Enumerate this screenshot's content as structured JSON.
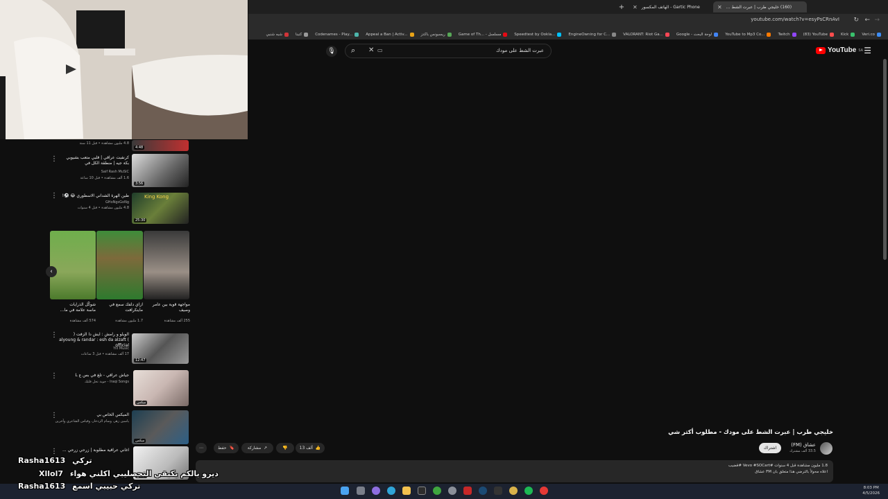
{
  "browser": {
    "tabs": [
      {
        "title": "Gartic Phone - الهاتف المكسور"
      },
      {
        "title": "(160) خليجي طرب | عبرت الشط ..."
      }
    ],
    "url": "youtube.com/watch?v=esyPsCRnAvI",
    "bookmarks": [
      "Veri.co",
      "Kick",
      "(83) YouTube",
      "Twitch",
      "YouTube to Mp3 Co...",
      "Google - لوحة البحث",
      "VALORANT: Riot Ga...",
      "EngineOwning for C...",
      "Speedtest by Ookla...",
      "Game of Th... - مسلسل",
      "ريسبونس باكدز",
      "Appeal a Ban | Activ...",
      "Codenames - Play...",
      "كتبنا",
      "شبه شنبي"
    ]
  },
  "youtube": {
    "logo_text": "YouTube",
    "region": "SA",
    "search_value": "عبرت الشط على مودك"
  },
  "sidebar": {
    "items": [
      {
        "title": "",
        "channel": "",
        "meta": "4.8 مليون مشاهدة • قبل 11 سنة",
        "duration": "4:48"
      },
      {
        "title": "كرنفيت عراقي | قلبي متعب بشيوبي بكة جيه | منطقة الكل في",
        "channel": "Saif Rash MuSiC",
        "meta": "1.6 ألف مشاهدة • قبل 10 ساعة",
        "duration": "3:56"
      },
      {
        "title": "طين الهرة الشداني الاسطوري 😂 ⚽!",
        "channel": "GHoNgsGoNg",
        "meta": "4.8 مليون مشاهدة • قبل 4 سنوات",
        "duration": "25:30"
      },
      {
        "title": "الويلو و رامش : ايش دا الزفت ( alyoung & randar : esh da alzaft ( official",
        "channel": "Yill Music",
        "meta": "17 ألف مشاهدة • قبل 3 ساعات",
        "duration": "12:47"
      },
      {
        "title": "جياش عراقي - تلغ في بس ع L",
        "channel": "Iraqi Songs - جوبة تحل قلبك",
        "meta": "",
        "duration": "ميكس"
      },
      {
        "title": "الميكس الخاص بي",
        "channel": "ياسين زهر، وسام الزدخار، وقياس الشاعري وآخرين",
        "meta": "",
        "duration": "ميكس"
      },
      {
        "title": "اغاني عراقية مطلوبة | زرحي زرحي ...",
        "channel": "",
        "meta": "",
        "duration": "ميكس"
      }
    ],
    "shorts": [
      {
        "title": "مواجهة قوية بين عامر وصيف",
        "views": "255 ألف مشاهدة"
      },
      {
        "title": "ازاي دلفك سمع في ماينكرافت",
        "views": "1.7 مليون مشاهدة"
      },
      {
        "title": "شوكّل الذرايات ماسة علامة في ما...",
        "views": "574 ألف مشاهدة"
      }
    ]
  },
  "video": {
    "title": "خليجي طرب | عبرت الشط على مودك - مطلوب أكثر شي",
    "channel": "عشاق (FM)",
    "subscribers": "33.5 ألف مشترك",
    "subscribe_label": "اشتراك",
    "likes": "13 ألف",
    "share_label": "مشاركة",
    "save_label": "حفظ",
    "description_meta": "1.8 مليون مشاهدة قبل 4 سنوات #Vevo #SOCart #قضيب",
    "description_line2": "اعلاه محولاً بالترضي هذا متعلق بان FM عشاق"
  },
  "stream_chat": [
    {
      "user": "Rasha1613",
      "text": "تركي"
    },
    {
      "user": "Xllol7",
      "text": "ديرو بالكم يكبقي التحصليبي اكلني هواء"
    },
    {
      "user": "Rasha1613",
      "text": "تركي حبيبي اسمع"
    }
  ],
  "taskbar": {
    "time": "8:03 PM",
    "date": "4/5/2026"
  },
  "colors": {
    "yt_red": "#ff0000",
    "background": "#0f0f0f",
    "taskbar": "#1c2230"
  }
}
